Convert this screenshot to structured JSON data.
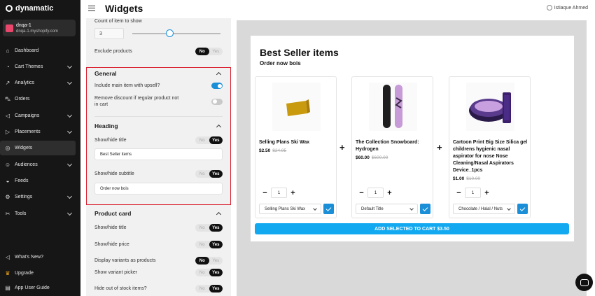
{
  "brand": {
    "name": "dynamatic"
  },
  "store": {
    "name": "dnqa-1",
    "url": "dnqa-1.myshopify.com"
  },
  "nav": [
    {
      "label": "Dashboard",
      "icon": "home-icon",
      "chevron": false
    },
    {
      "label": "Cart Themes",
      "icon": "palette-icon",
      "chevron": true
    },
    {
      "label": "Analytics",
      "icon": "chart-icon",
      "chevron": true
    },
    {
      "label": "Orders",
      "icon": "cart-icon",
      "chevron": false
    },
    {
      "label": "Campaigns",
      "icon": "megaphone-icon",
      "chevron": true
    },
    {
      "label": "Placements",
      "icon": "placement-icon",
      "chevron": true
    },
    {
      "label": "Widgets",
      "icon": "widget-icon",
      "chevron": false,
      "active": true
    },
    {
      "label": "Audiences",
      "icon": "people-icon",
      "chevron": true
    },
    {
      "label": "Feeds",
      "icon": "feed-icon",
      "chevron": false
    },
    {
      "label": "Settings",
      "icon": "gear-icon",
      "chevron": true
    },
    {
      "label": "Tools",
      "icon": "tools-icon",
      "chevron": true
    }
  ],
  "nav_bottom": [
    {
      "label": "What's New?",
      "icon": "megaphone-icon"
    },
    {
      "label": "Upgrade",
      "icon": "crown-icon"
    },
    {
      "label": "App User Guide",
      "icon": "book-icon"
    }
  ],
  "header": {
    "title": "Widgets",
    "user": "Istiaque Ahmed"
  },
  "settings": {
    "count_label": "Count of item to show",
    "count_value": "3",
    "exclude_label": "Exclude products",
    "no": "No",
    "yes": "Yes",
    "general": {
      "title": "General",
      "include_main": "Include main item with upsell?",
      "include_main_on": true,
      "remove_discount": "Remove discount if regular product not in cart",
      "remove_discount_on": false
    },
    "heading": {
      "title": "Heading",
      "title_toggle": "Show/hide title",
      "title_value": "Best Seller items",
      "subtitle_toggle": "Show/hide subtitle",
      "subtitle_value": "Order now bois"
    },
    "product_card": {
      "title": "Product card",
      "rows": [
        {
          "label": "Show/hide title",
          "value": "Yes"
        },
        {
          "label": "Show/hide price",
          "value": "Yes"
        },
        {
          "label": "Display variants as products",
          "value": "No"
        },
        {
          "label": "Show variant picker",
          "value": "Yes"
        },
        {
          "label": "Hide out of stock items?",
          "value": "Yes"
        }
      ]
    }
  },
  "preview": {
    "title": "Best Seller items",
    "subtitle": "Order now bois",
    "products": [
      {
        "name": "Selling Plans Ski Wax",
        "price": "$2.50",
        "old_price": "$24.95",
        "qty": "1",
        "variant": "Selling Plans Ski Wax"
      },
      {
        "name": "The Collection Snowboard: Hydrogen",
        "price": "$60.00",
        "old_price": "$600.00",
        "qty": "1",
        "variant": "Default Title"
      },
      {
        "name": "Cartoon Print Big Size Silica gel childrens hygienic nasal aspirator for nose Nose Cleaning/Nasal Aspirators Device_1pcs",
        "price": "$1.00",
        "old_price": "$10.00",
        "qty": "1",
        "variant": "Chocolate / Halal / Nuts"
      }
    ],
    "cta": "ADD SELECTED TO CART $3.50"
  },
  "colors": {
    "accent": "#1a8fd8",
    "cta": "#12a9f0",
    "sidebar": "#161616",
    "highlight": "#d9202f"
  }
}
